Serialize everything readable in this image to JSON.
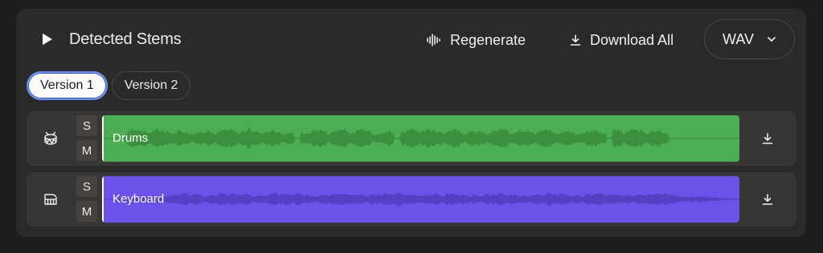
{
  "header": {
    "title": "Detected Stems",
    "regenerate_label": "Regenerate",
    "download_all_label": "Download All",
    "format_value": "WAV"
  },
  "tabs": [
    {
      "label": "Version 1",
      "active": true
    },
    {
      "label": "Version 2",
      "active": false
    }
  ],
  "stems": [
    {
      "name": "Drums",
      "solo": "S",
      "mute": "M",
      "icon": "drum-icon",
      "color": "#4cae52",
      "wave_color": "#3b8f3f"
    },
    {
      "name": "Keyboard",
      "solo": "S",
      "mute": "M",
      "icon": "keyboard-icon",
      "color": "#6a52ea",
      "wave_color": "#5540c4"
    }
  ],
  "colors": {
    "background": "#1f1d1c",
    "panel": "#2c2a29",
    "row": "#383634",
    "active_tab_border": "#6d8ff0"
  }
}
